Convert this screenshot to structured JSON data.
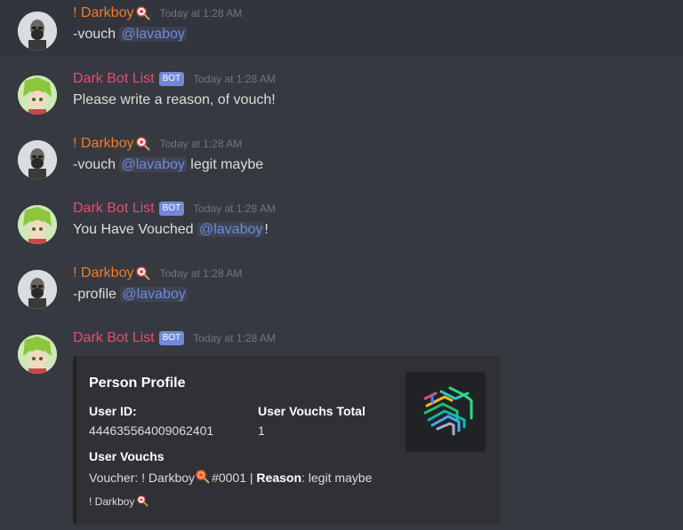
{
  "messages": [
    {
      "author": "! Darkboy",
      "time": "Today at 1:28 AM",
      "text_before": "-vouch ",
      "mention": "@lavaboy",
      "text_after": ""
    },
    {
      "author": "Dark Bot List",
      "badge": "BOT",
      "time": "Today at 1:28 AM",
      "text": "Please write a reason, of vouch!"
    },
    {
      "author": "! Darkboy",
      "time": "Today at 1:28 AM",
      "text_before": "-vouch ",
      "mention": "@lavaboy",
      "text_after": " legit maybe"
    },
    {
      "author": "Dark Bot List",
      "badge": "BOT",
      "time": "Today at 1:28 AM",
      "text_before": "You Have Vouched ",
      "mention": "@lavaboy",
      "text_after": "!"
    },
    {
      "author": "! Darkboy",
      "time": "Today at 1:28 AM",
      "text_before": "-profile ",
      "mention": "@lavaboy",
      "text_after": ""
    },
    {
      "author": "Dark Bot List",
      "badge": "BOT",
      "time": "Today at 1:28 AM"
    }
  ],
  "embed": {
    "title": "Person Profile",
    "field1_name": "User ID:",
    "field1_value": "444635564009062401",
    "field2_name": "User Vouchs Total",
    "field2_value": "1",
    "field3_name": "User Vouchs",
    "voucher_prefix": "Voucher: ! Darkboy",
    "voucher_tag": "#0001 | ",
    "reason_label": "Reason",
    "reason_value": ": legit maybe",
    "footer": "! Darkboy"
  },
  "colors": {
    "background": "#36393f",
    "darkboy_name": "#f47b2c",
    "bot_name": "#e84a7a",
    "mention": "#7289da",
    "bot_badge": "#7289da"
  }
}
